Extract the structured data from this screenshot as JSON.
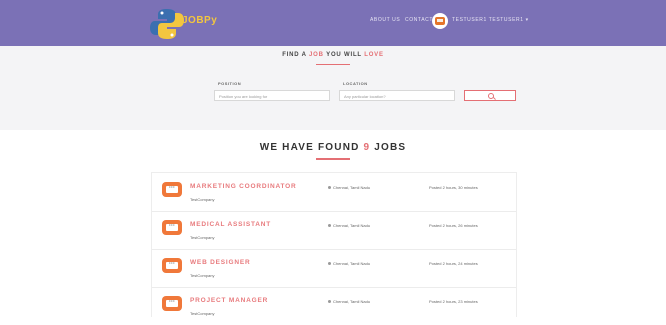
{
  "header": {
    "brand": "JOBPy",
    "nav": [
      "ABOUT US",
      "CONTACT"
    ],
    "user": "TESTUSER1 TESTUSER1 ▾"
  },
  "search": {
    "title_pre": "FIND A ",
    "title_hl1": "JOB",
    "title_mid": " YOU WILL ",
    "title_hl2": "LOVE",
    "position_label": "POSITION",
    "position_placeholder": "Position you are looking for",
    "location_label": "LOCATION",
    "location_placeholder": "Any particular location?"
  },
  "results": {
    "pre": "WE HAVE FOUND ",
    "count": "9",
    "post": " JOBS"
  },
  "jobs": [
    {
      "title": "MARKETING COORDINATOR",
      "company": "TestCompany",
      "location": "Chennai, Tamil Nadu",
      "posted": "Posted 2 hours, 30 minutes"
    },
    {
      "title": "MEDICAL ASSISTANT",
      "company": "TestCompany",
      "location": "Chennai, Tamil Nadu",
      "posted": "Posted 2 hours, 26 minutes"
    },
    {
      "title": "WEB DESIGNER",
      "company": "TestCompany",
      "location": "Chennai, Tamil Nadu",
      "posted": "Posted 2 hours, 24 minutes"
    },
    {
      "title": "PROJECT MANAGER",
      "company": "TestCompany",
      "location": "Chennai, Tamil Nadu",
      "posted": "Posted 2 hours, 23 minutes"
    }
  ],
  "icons": {
    "logo": "python-logo-icon",
    "avatar": "laptop-avatar-icon",
    "search": "search-icon",
    "job": "laptop-icon",
    "location": "location-pin-icon"
  },
  "colors": {
    "header": "#7b71b6",
    "accent": "#e46f74",
    "brand": "#f3c63f",
    "job_icon": "#f0783a"
  }
}
